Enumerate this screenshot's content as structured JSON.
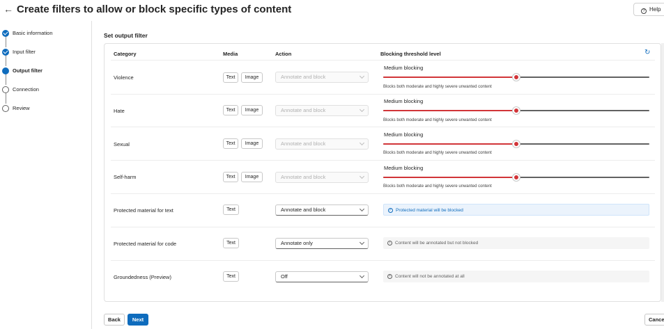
{
  "header": {
    "back_icon": "arrow-left-icon",
    "title": "Create filters to allow or block specific types of content",
    "help_label": "Help",
    "help_icon": "question-circle-icon"
  },
  "stepper": {
    "steps": [
      {
        "label": "Basic information",
        "state": "done"
      },
      {
        "label": "Input filter",
        "state": "done"
      },
      {
        "label": "Output filter",
        "state": "current"
      },
      {
        "label": "Connection",
        "state": "todo"
      },
      {
        "label": "Review",
        "state": "todo"
      }
    ]
  },
  "main": {
    "section_title": "Set output filter",
    "columns": {
      "category": "Category",
      "media": "Media",
      "action": "Action",
      "threshold": "Blocking threshold level"
    },
    "reset_icon": "reset-icon",
    "rows": [
      {
        "category": "Violence",
        "media": [
          "Text",
          "Image"
        ],
        "action": "Annotate and block",
        "action_enabled": false,
        "threshold_label": "Medium blocking",
        "threshold_level": 0.5,
        "threshold_desc": "Blocks both moderate and highly severe unwanted content"
      },
      {
        "category": "Hate",
        "media": [
          "Text",
          "Image"
        ],
        "action": "Annotate and block",
        "action_enabled": false,
        "threshold_label": "Medium blocking",
        "threshold_level": 0.5,
        "threshold_desc": "Blocks both moderate and highly severe unwanted content"
      },
      {
        "category": "Sexual",
        "media": [
          "Text",
          "Image"
        ],
        "action": "Annotate and block",
        "action_enabled": false,
        "threshold_label": "Medium blocking",
        "threshold_level": 0.5,
        "threshold_desc": "Blocks both moderate and highly severe unwanted content"
      },
      {
        "category": "Self-harm",
        "media": [
          "Text",
          "Image"
        ],
        "action": "Annotate and block",
        "action_enabled": false,
        "threshold_label": "Medium blocking",
        "threshold_level": 0.5,
        "threshold_desc": "Blocks both moderate and highly severe unwanted content"
      },
      {
        "category": "Protected material for text",
        "media": [
          "Text"
        ],
        "action": "Annotate and block",
        "action_enabled": true,
        "info": "Protected material will be blocked",
        "info_style": "blue",
        "info_icon": "shield-check-icon"
      },
      {
        "category": "Protected material for code",
        "media": [
          "Text"
        ],
        "action": "Annotate only",
        "action_enabled": true,
        "info": "Content will be annotated but not blocked",
        "info_style": "gray",
        "info_icon": "info-circle-icon"
      },
      {
        "category": "Groundedness (Preview)",
        "media": [
          "Text"
        ],
        "action": "Off",
        "action_enabled": true,
        "info": "Content will not be annotated at all",
        "info_style": "gray",
        "info_icon": "dismiss-circle-icon"
      }
    ]
  },
  "footer": {
    "back_label": "Back",
    "next_label": "Next",
    "cancel_label": "Cancel"
  },
  "colors": {
    "accent": "#0f6cbd",
    "slider_fill": "#d13438",
    "info_blue_bg": "#ebf3fc"
  }
}
